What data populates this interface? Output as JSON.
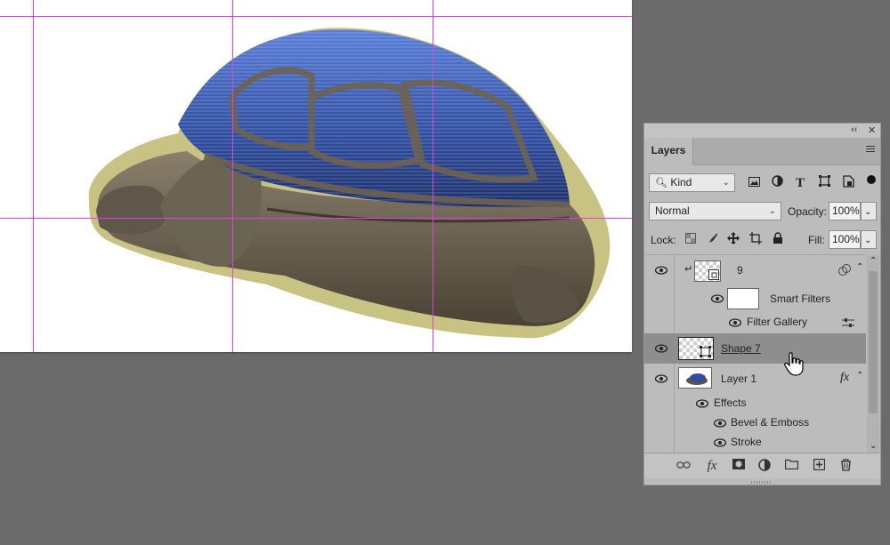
{
  "panel": {
    "collapse_glyph": "‹‹",
    "close_glyph": "✕",
    "tab_label": "Layers",
    "menu_icon": "hamburger-menu-icon"
  },
  "filter": {
    "kind_label": "Kind",
    "icons": [
      "image-filter-icon",
      "adjustment-filter-icon",
      "type-filter-icon",
      "shape-filter-icon",
      "smart-object-filter-icon"
    ]
  },
  "blend": {
    "mode": "Normal",
    "opacity_label": "Opacity:",
    "opacity_value": "100%"
  },
  "lock": {
    "label": "Lock:",
    "fill_label": "Fill:",
    "fill_value": "100%"
  },
  "layers": {
    "layer9_name": "9",
    "smart_filters_label": "Smart Filters",
    "filter_gallery_label": "Filter Gallery",
    "shape7_name": "Shape 7",
    "layer1_name": "Layer 1",
    "fx_badge": "fx",
    "effects_label": "Effects",
    "bevel_label": "Bevel & Emboss",
    "stroke_label": "Stroke"
  },
  "bottom": {
    "fx_label": "fx"
  },
  "colors": {
    "guides": "#e040e0",
    "panel_bg": "#bcbcbc",
    "workspace": "#6b6b6b",
    "selected_row": "#8e8e8e",
    "shell_blue": "#3b5bb0"
  }
}
